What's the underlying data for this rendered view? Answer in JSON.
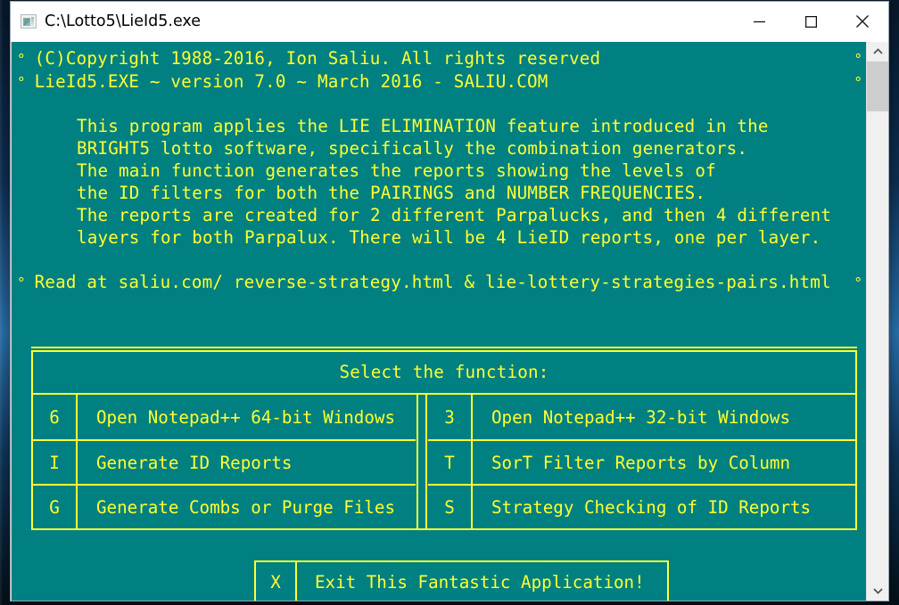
{
  "window": {
    "title": "C:\\Lotto5\\LieId5.exe",
    "icon": "console-window-icon",
    "minimize_label": "Minimize",
    "maximize_label": "Maximize",
    "close_label": "Close"
  },
  "colors": {
    "console_background": "#008080",
    "console_text": "#ffff33",
    "titlebar_background": "#ffffff",
    "scrollbar_thumb": "#cdcdcd"
  },
  "console": {
    "marker": "°",
    "header_lines": [
      "(C)Copyright 1988-2016, Ion Saliu. All rights reserved",
      "LieId5.EXE ~ version 7.0 ~ March 2016 - SALIU.COM"
    ],
    "paragraph": [
      "This program applies the LIE ELIMINATION feature introduced in the",
      "BRIGHT5 lotto software, specifically the combination generators.",
      "The main function generates the reports showing the levels of",
      "the ID filters for both the PAIRINGS and NUMBER FREQUENCIES.",
      "The reports are created for 2 different Parpalucks, and then 4 different",
      "layers for both Parpalux. There will be 4 LieID reports, one per layer."
    ],
    "read_line": "Read at saliu.com/ reverse-strategy.html & lie-lottery-strategies-pairs.html"
  },
  "menu": {
    "title": "Select the function:",
    "left_column": [
      {
        "key": "6",
        "label": "Open Notepad++ 64-bit Windows"
      },
      {
        "key": "I",
        "label": "Generate ID Reports"
      },
      {
        "key": "G",
        "label": "Generate Combs or Purge Files"
      }
    ],
    "right_column": [
      {
        "key": "3",
        "label": "Open Notepad++ 32-bit Windows"
      },
      {
        "key": "T",
        "label": "SorT Filter Reports by Column"
      },
      {
        "key": "S",
        "label": "Strategy Checking of ID Reports"
      }
    ],
    "exit": {
      "key": "X",
      "label": "Exit This Fantastic Application!"
    }
  },
  "scrollbar": {
    "up_arrow": "chevron-up-icon",
    "down_arrow": "chevron-down-icon"
  }
}
